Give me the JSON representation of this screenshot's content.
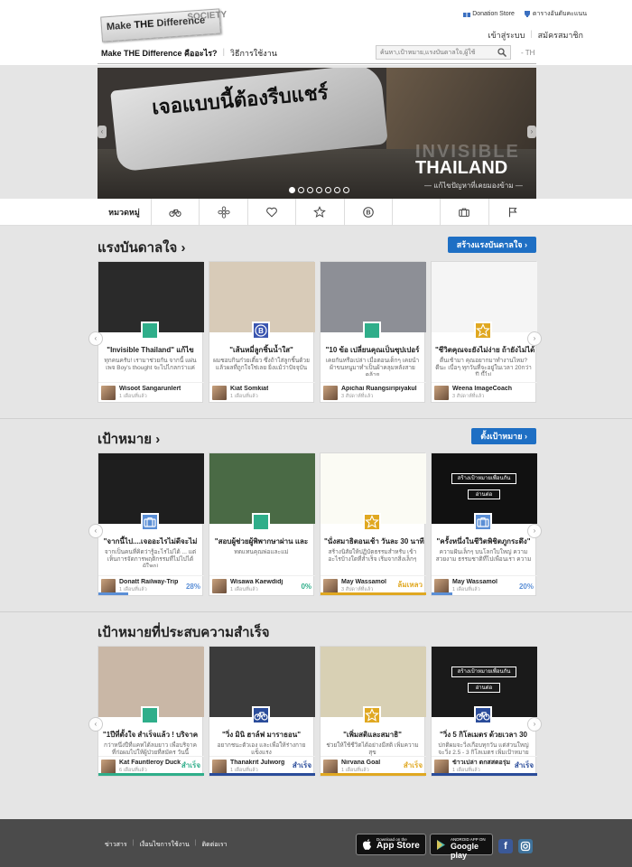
{
  "header": {
    "logo_text_1": "Make ",
    "logo_text_bold": "THE",
    "logo_text_2": " Difference",
    "logo_text_3": "SOCIETY",
    "donation_store": "Donation Store",
    "ranking": "ตารางอันดับคะแนน",
    "login": "เข้าสู่ระบบ",
    "signup": "สมัครสมาชิก",
    "nav_about": "Make THE Difference คืออะไร?",
    "nav_howto": "วิธีการใช้งาน",
    "search_placeholder": "ค้นหา,เป้าหมาย,แรงบันดาลใจ,ผู้ใช้",
    "lang": "- TH"
  },
  "slider": {
    "headline": "เจอแบบนี้ต้องรีบแชร์",
    "invisible": "INVISIBLE",
    "thailand": "THAILAND",
    "subtitle": "— แก้ไขปัญหาที่เคยมองข้าม —",
    "dot_count": 7,
    "active_dot": 0
  },
  "categories": {
    "label": "หมวดหมู่",
    "icons": [
      "bicycle-icon",
      "flower-icon",
      "heart-icon",
      "star-icon",
      "b-icon",
      "leaf-icon",
      "briefcase-icon",
      "flag-icon"
    ]
  },
  "inspiration": {
    "title": "แรงบันดาลใจ ›",
    "button": "สร้างแรงบันดาลใจ ›",
    "cards": [
      {
        "title": "\"Invisible Thailand\" แก้ไข",
        "desc": "ทุกคนครับ! เรามาช่วยกัน จากนี้ แผ่นเพจ Boy's thought จะไปไกลกว่าแค่",
        "user": "Wisoot Sangarunlert",
        "time": "1 เดือนที่แล้ว",
        "badge": "leaf-icon",
        "color": "#2fae8a",
        "img": "#2a2a2a"
      },
      {
        "title": "\"เส้นหมี่ลูกชิ้นน้ำใส\"",
        "desc": "ผมชอบกินก๋วยเตี๋ยว ซึ่งถ้าใส่ลูกชิ้นด้วย แล้วผลที่ถูกใจใช่เลย ยิ่งแม้ว่าปัจจุบัน",
        "user": "Kiat Somkiat",
        "time": "1 เดือนที่แล้ว",
        "badge": "b-icon",
        "color": "#3a55b0",
        "img": "#d8cbb8"
      },
      {
        "title": "\"10 ข้อ เปลี่ยนคุณเป็นซุปเปอร์",
        "desc": "เคยกันหรือเปล่า เมื่อตอนเด็กๆ เคยนำผ้าขนหนูมาทำเป็นผ้าคลุมหลังสายคล้าย",
        "user": "Apichai Ruangsiripiyakul",
        "time": "3 สัปดาห์ที่แล้ว",
        "badge": "leaf-icon",
        "color": "#2fae8a",
        "img": "#8d8f96"
      },
      {
        "title": "\"ชีวิตคุณจะยังไม่ง่าย ถ้ายังไม่ได้",
        "desc": "ตื่นเช้ามา คุณอยากมาทำงานไหม? ดีนะ เบื่อๆ ทุกวันที่จะอยู่ในเวลา 20กว่าปี นี้ไม่",
        "user": "Weena ImageCoach",
        "time": "3 สัปดาห์ที่แล้ว",
        "badge": "star-icon",
        "color": "#e0a821",
        "img": "#f5f5f5"
      }
    ]
  },
  "goals": {
    "title": "เป้าหมาย ›",
    "button": "ตั้งเป้าหมาย ›",
    "cards": [
      {
        "title": "\"จากนี้ไป....เจออะไรไม่ดีจะไม่",
        "desc": "จากเป็นคนที่คิดว่ารู้อะไรไม่ได้ ... แต่เห็นการจัดการพฤติกรรมที่ไม่ไปได้ผู้ใหญ่",
        "user": "Donatt Railway-Trip",
        "time": "1 เดือนที่แล้ว",
        "badge": "briefcase-icon",
        "color": "#5b8fd6",
        "img": "#1e1e1e",
        "pct": "28%",
        "pct_val": 0.28,
        "pct_color": "#5b8fd6"
      },
      {
        "title": "\"สอบผู้ช่วยผู้พิพากษาผ่าน และ",
        "desc": "ทดแทนคุณพ่อและแม่",
        "user": "Wisawa Kaewdidj",
        "time": "1 เดือนที่แล้ว",
        "badge": "leaf-icon",
        "color": "#2fae8a",
        "img": "#4a6a45",
        "pct": "0%",
        "pct_val": 0,
        "pct_color": "#2fae8a"
      },
      {
        "title": "\"นั่งสมาธิตอนเช้า วันละ 30 นาที",
        "desc": "สร้างนิสัยให้ปฏิบัตธรรมสำหรับ เข้า อะไรบ้างใดที่สำเร็จ เริ่มจากสิ่งเล็กๆ",
        "user": "May Wassamol",
        "time": "3 สัปดาห์ที่แล้ว",
        "badge": "star-icon",
        "color": "#e0a821",
        "img": "#fbfbf4",
        "pct": "ล้มเหลว",
        "pct_val": 1,
        "pct_color": "#e0a821"
      },
      {
        "title": "\"ครั้งหนึ่งในชีวิตพิชิตภูกระดึง\"",
        "desc": "ความฝันเล็กๆ บนโลกใบใหญ่ ความสวยงาม ธรรมชาติที่ไปเพื่อนเรา ความ",
        "user": "May Wassamol",
        "time": "1 เดือนที่แล้ว",
        "badge": "briefcase-icon",
        "color": "#5b8fd6",
        "img": "#111111",
        "pct": "20%",
        "pct_val": 0.2,
        "pct_color": "#5b8fd6",
        "overlay_btn": "สร้างเป้าหมายเพื่อนกัน",
        "overlay_sub": "อ่านต่อ"
      }
    ]
  },
  "success": {
    "title": "เป้าหมายที่ประสบความสำเร็จ",
    "cards": [
      {
        "title": "\"1ปีที่ตั้งใจ สำเร็จแล้ว ! บริจาค",
        "desc": "กว่าหนึ่งปีที่แคทได้ลมยาว เพื่อบริจาค ที่ก่อผมไปให้ผู้ป่วยที่สมัคร วันนี้",
        "user": "Kat Fauntleroy Duck",
        "time": "6 เดือนที่แล้ว",
        "badge": "leaf-icon",
        "color": "#2fae8a",
        "img": "#c9b7a6",
        "status": "สำเร็จ"
      },
      {
        "title": "\"วิ่ง มินิ ฮาล์ฟ มาราธอน\"",
        "desc": "อยากชนะตัวเอง และเพื่อให้ร่างกายแข็งแรง",
        "user": "Thanakrit Julworg",
        "time": "1 เดือนที่แล้ว",
        "badge": "bicycle-icon",
        "color": "#2a4c9a",
        "img": "#3b3b3b",
        "status": "สำเร็จ"
      },
      {
        "title": "\"เพิ่มสติและสมาธิ\"",
        "desc": "ช่วยให้ใช้ชีวิตได้อย่างมีสติ เพิ่มความสุข",
        "user": "Nirvana Goal",
        "time": "1 เดือนที่แล้ว",
        "badge": "star-icon",
        "color": "#e0a821",
        "img": "#d8d0b4",
        "status": "สำเร็จ"
      },
      {
        "title": "\"วิ่ง 5 กิโลเมตร ด้วยเวลา 30",
        "desc": "ปกติผมจะวิ่งเกือบทุกวัน แต่ส่วนใหญ่จะวิ่ง 2.5 - 3 กิโลเมตร เพิ่มเป้าหมาย",
        "user": "ข้าวเปล่า ตกสสตอรุ่ม",
        "time": "1 เดือนที่แล้ว",
        "badge": "bicycle-icon",
        "color": "#2a4c9a",
        "img": "#1a1a1a",
        "status": "สำเร็จ",
        "overlay_btn": "สร้างเป้าหมายเพื่อนกัน",
        "overlay_sub": "อ่านต่อ"
      }
    ]
  },
  "footer": {
    "news": "ข่าวสาร",
    "terms": "เงื่อนไขการใช้งาน",
    "contact": "ติดต่อเรา",
    "appstore_small": "Download on the",
    "appstore_big": "App Store",
    "play_small": "ANDROID APP ON",
    "play_big": "Google play"
  }
}
